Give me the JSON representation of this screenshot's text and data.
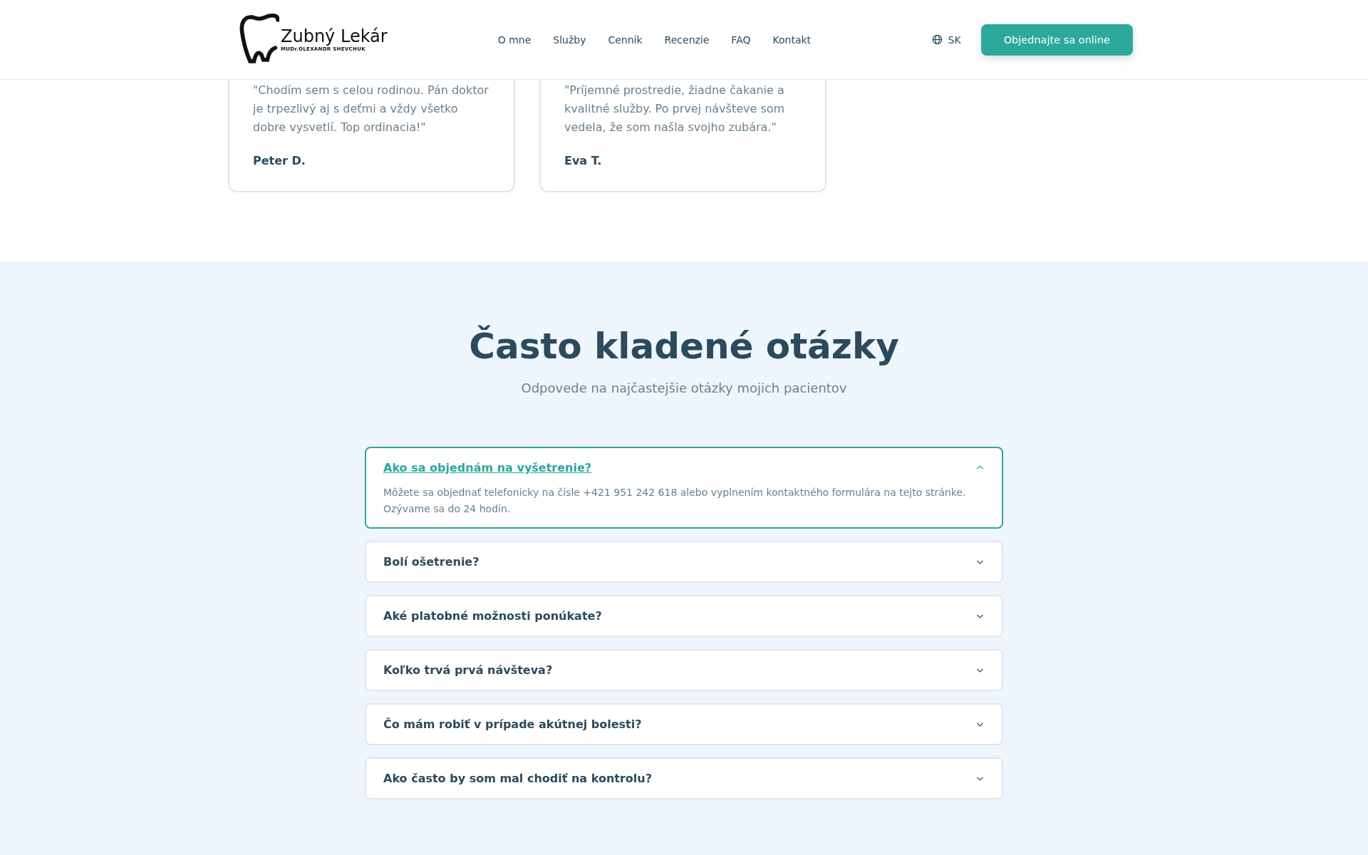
{
  "header": {
    "logo": {
      "title": "Zubný Lekár",
      "subtitle": "MUDr.OLEXANDR SHEVCHUK"
    },
    "nav": [
      "O mne",
      "Služby",
      "Cenník",
      "Recenzie",
      "FAQ",
      "Kontakt"
    ],
    "language": "SK",
    "cta": "Objednajte sa online"
  },
  "reviews": [
    {
      "quote": "\"Chodím sem s celou rodinou. Pán doktor je trpezlivý aj s deťmi a vždy všetko dobre vysvetlí. Top ordinacia!\"",
      "author": "Peter D."
    },
    {
      "quote": "\"Príjemné prostredie, žiadne čakanie a kvalitné služby. Po prvej návšteve som vedela, že som našla svojho zubára.\"",
      "author": "Eva T."
    }
  ],
  "faq": {
    "title": "Často kladené otázky",
    "subtitle": "Odpovede na najčastejšie otázky mojich pacientov",
    "items": [
      {
        "question": "Ako sa objednám na vyšetrenie?",
        "expanded": true,
        "answer": "Môžete sa objednať telefonicky na čísle +421 951 242 618 alebo vyplnením kontaktného formulára na tejto stránke. Ozývame sa do 24 hodín."
      },
      {
        "question": "Bolí ošetrenie?",
        "expanded": false
      },
      {
        "question": "Aké platobné možnosti ponúkate?",
        "expanded": false
      },
      {
        "question": "Koľko trvá prvá návšteva?",
        "expanded": false
      },
      {
        "question": "Čo mám robiť v prípade akútnej bolesti?",
        "expanded": false
      },
      {
        "question": "Ako často by som mal chodiť na kontrolu?",
        "expanded": false
      }
    ]
  }
}
